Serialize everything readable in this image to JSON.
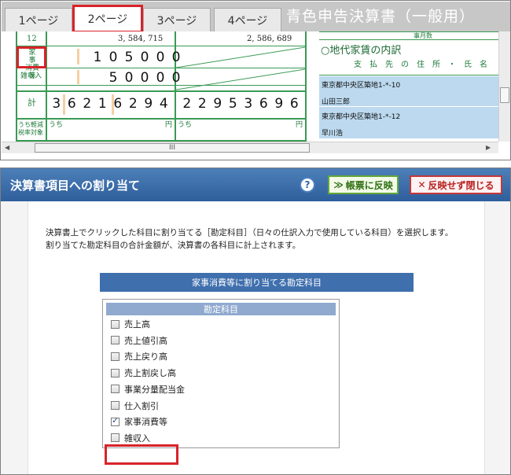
{
  "tabs": [
    {
      "label": "1ページ"
    },
    {
      "label": "2ページ"
    },
    {
      "label": "3ページ"
    },
    {
      "label": "4ページ"
    }
  ],
  "document_title": "青色申告決算書（一般用）",
  "form": {
    "row_12": {
      "number": "12",
      "amount_left": "3, 584, 715",
      "amount_right": "2, 586, 689"
    },
    "household": {
      "label_line1": "家　事",
      "label_line2": "消費等",
      "digits": "105000"
    },
    "misc_income": {
      "label": "雑収入",
      "digits": "50000"
    },
    "total": {
      "label": "計",
      "digits_left": "36216294",
      "digits_right": "22953696"
    },
    "tax_row": {
      "label_line1": "うち軽減",
      "label_line2": "税率対象",
      "uchi_left": "うち",
      "yen_left": "円",
      "uchi_right": "うち",
      "yen_right": "円"
    },
    "months_label": "事月数"
  },
  "address_panel": {
    "heading": "○地代家賃の内訳",
    "subheading": "支　払　先　の　住　所　・　氏　名",
    "rows": [
      {
        "address": "東京都中央区築地1-*-10",
        "name": "山田三郎"
      },
      {
        "address": "東京都中央区築地1-*-12",
        "name": "早川浩"
      }
    ]
  },
  "scrollbar": {
    "thumb_grip": "III",
    "left_arrow": "◀",
    "right_arrow": "▶"
  },
  "dialog": {
    "title": "決算書項目への割り当て",
    "help_icon_label": "?",
    "reflect_icon": "≫",
    "reflect_label": "帳票に反映",
    "close_icon": "✕",
    "close_label": "反映せず閉じる",
    "description_line1": "決算書上でクリックした科目に割り当てる［勘定科目］（日々の仕訳入力で使用している科目）を選択します。",
    "description_line2": "割り当てた勘定科目の合計金額が、決算書の各科目に計上されます。",
    "assign_header": "家事消費等に割り当てる勘定科目",
    "list_header": "勘定科目",
    "items": [
      {
        "label": "売上高",
        "checked": false
      },
      {
        "label": "売上値引高",
        "checked": false
      },
      {
        "label": "売上戻り高",
        "checked": false
      },
      {
        "label": "売上割戻し高",
        "checked": false
      },
      {
        "label": "事業分量配当金",
        "checked": false
      },
      {
        "label": "仕入割引",
        "checked": false
      },
      {
        "label": "家事消費等",
        "checked": true
      },
      {
        "label": "雑収入",
        "checked": false
      }
    ],
    "check_mark": "✓"
  },
  "colors": {
    "tab_highlight": "#d8232a",
    "form_green": "#3a9a55",
    "header_blue": "#3f6fad",
    "address_bg": "#bcd9ef"
  }
}
